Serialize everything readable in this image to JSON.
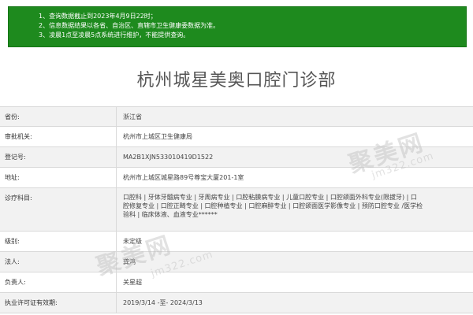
{
  "notice": {
    "lines": [
      "1、查询数据截止到2023年4月9日22时；",
      "2、信息数据结果以各省、自治区、直辖市卫生健康委数据为准。",
      "3、凌晨1点至凌晨5点系统进行维护，不能提供查询。"
    ]
  },
  "title": "杭州城星美奥口腔门诊部",
  "rows": [
    {
      "label": "省份:",
      "value": "浙江省"
    },
    {
      "label": "审批机关:",
      "value": "杭州市上城区卫生健康局"
    },
    {
      "label": "登记号:",
      "value": "MA2B1XJN533010419D1522"
    },
    {
      "label": "地址:",
      "value": "杭州市上城区城星路89号尊宝大厦201-1室"
    },
    {
      "label": "诊疗科目:",
      "value_lines": [
        "口腔科 | 牙体牙髓病专业 | 牙周病专业 | 口腔粘膜病专业 | 儿童口腔专业 | 口腔颌面外科专业(限拔牙) | 口",
        "腔修复专业 | 口腔正畸专业 | 口腔种植专业 | 口腔麻醉专业 | 口腔颌面医学影像专业 | 预防口腔专业 /医学检",
        "验科 | 临床体液、血液专业******"
      ]
    },
    {
      "label": "级别:",
      "value": "未定级"
    },
    {
      "label": "法人:",
      "value": "龚鸿"
    },
    {
      "label": "负责人:",
      "value": "关星超"
    },
    {
      "label": "执业许可证有效期:",
      "value": "2019/3/14 -至- 2024/3/13"
    }
  ],
  "watermark": {
    "brand": "聚美网",
    "url": "jm322.com"
  }
}
